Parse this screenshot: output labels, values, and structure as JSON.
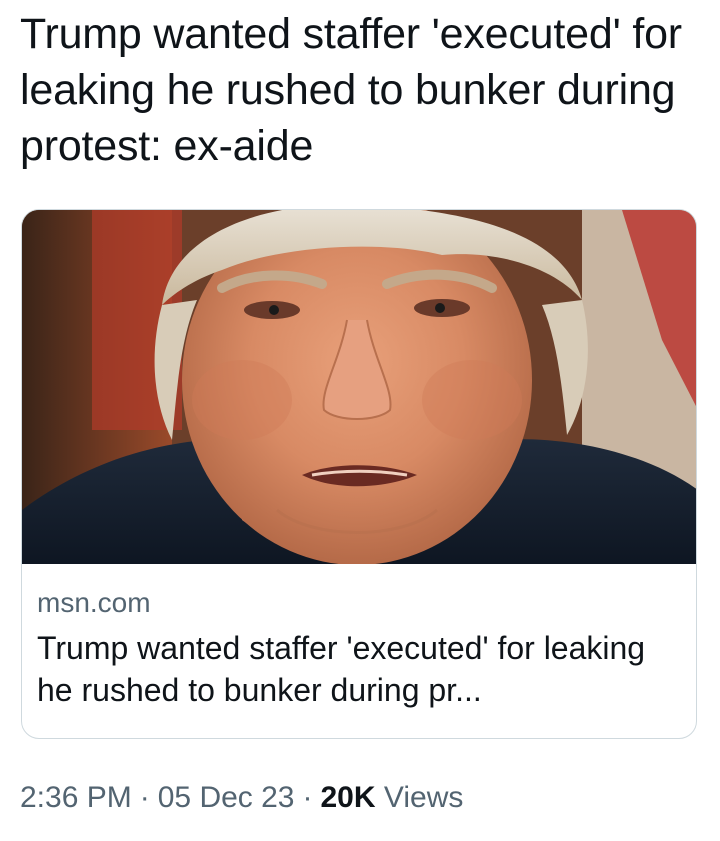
{
  "tweet": {
    "text": "Trump wanted staffer 'executed' for leaking he rushed to bunker during protest: ex-aide"
  },
  "link_card": {
    "domain": "msn.com",
    "title": "Trump wanted staffer 'executed' for leaking he rushed to bunker during pr...",
    "image_subject": "photo of a man's face"
  },
  "meta": {
    "time": "2:36 PM",
    "date": "05 Dec 23",
    "views_count": "20K",
    "views_label": "Views",
    "separator": "·"
  },
  "colors": {
    "text_primary": "#0f1419",
    "text_secondary": "#536471",
    "card_border": "#cfd9de"
  }
}
